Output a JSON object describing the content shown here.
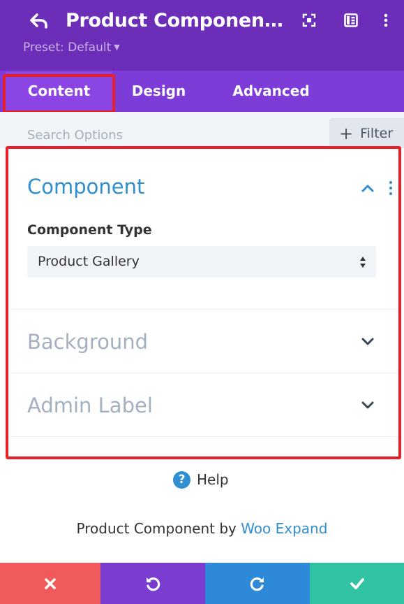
{
  "header": {
    "title": "Product Component S...",
    "preset_label": "Preset: Default",
    "icons": [
      "back-arrow-icon",
      "focus-frame-icon",
      "sidebar-layout-icon",
      "more-vertical-icon",
      "caret-down-icon"
    ]
  },
  "tabs": [
    {
      "label": "Content",
      "active": true
    },
    {
      "label": "Design",
      "active": false
    },
    {
      "label": "Advanced",
      "active": false
    }
  ],
  "search": {
    "placeholder": "Search Options",
    "filter_label": "Filter"
  },
  "sections": [
    {
      "title": "Component",
      "expanded": true
    },
    {
      "title": "Background",
      "expanded": false
    },
    {
      "title": "Admin Label",
      "expanded": false
    }
  ],
  "component": {
    "field_label": "Component Type",
    "selected_value": "Product Gallery"
  },
  "help": {
    "icon": "?",
    "label": "Help"
  },
  "credit": {
    "prefix": "Product Component by",
    "link_text": "Woo Expand"
  },
  "footer": {
    "buttons": [
      {
        "name": "cancel",
        "icon": "close-icon",
        "color": "#f05a5a"
      },
      {
        "name": "undo",
        "icon": "undo-icon",
        "color": "#7a3dd0"
      },
      {
        "name": "redo",
        "icon": "redo-icon",
        "color": "#2e8ad8"
      },
      {
        "name": "save",
        "icon": "check-icon",
        "color": "#2fc3a4"
      }
    ]
  },
  "colors": {
    "header_bg": "#6c2eb9",
    "tabs_bg": "#7d3bd7",
    "active_tab_bg": "#8a45e4",
    "accent_blue": "#2f8fd1",
    "highlight_red": "#e8202a"
  }
}
